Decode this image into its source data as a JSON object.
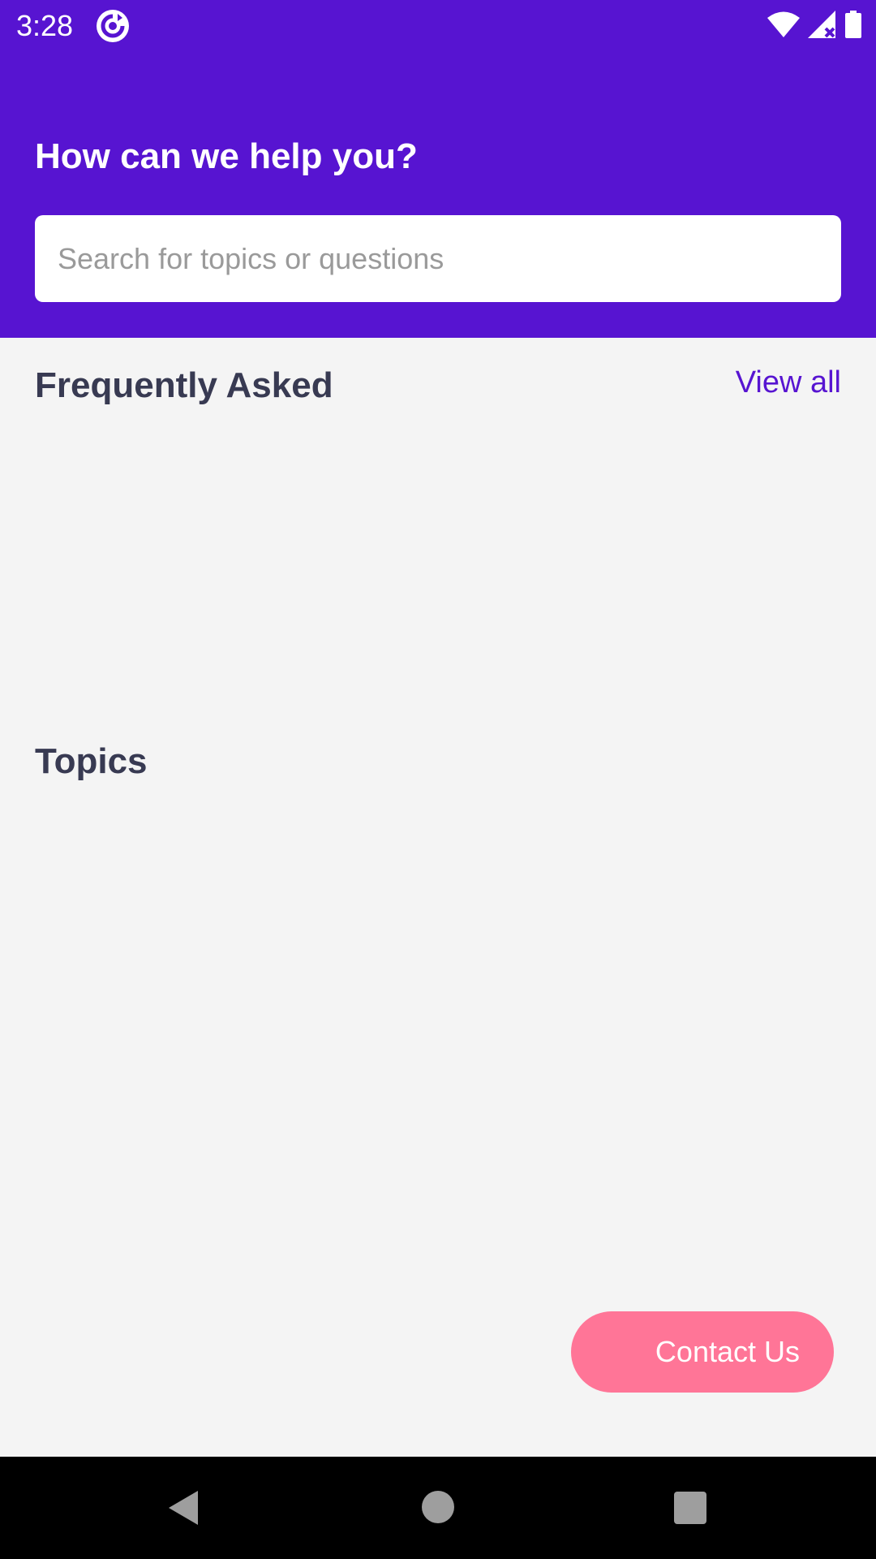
{
  "status_bar": {
    "time": "3:28",
    "app_icon": "sync-icon",
    "icons": [
      "wifi-icon",
      "signal-icon",
      "battery-icon"
    ]
  },
  "header": {
    "title": "How can we help you?",
    "search_placeholder": "Search for topics or questions",
    "search_value": ""
  },
  "faq": {
    "title": "Frequently Asked",
    "view_all_label": "View all"
  },
  "topics": {
    "title": "Topics"
  },
  "contact_button": {
    "label": "Contact Us"
  },
  "nav_bar": {
    "icons": [
      "back-icon",
      "home-icon",
      "recents-icon"
    ]
  },
  "colors": {
    "primary": "#5714d1",
    "accent": "#ff7597",
    "background": "#f4f4f4",
    "heading": "#383a52"
  }
}
